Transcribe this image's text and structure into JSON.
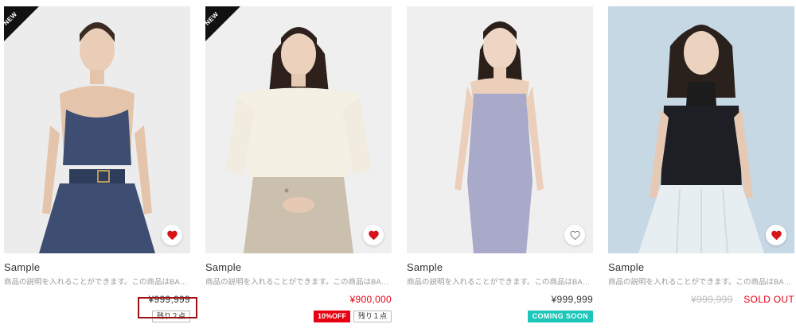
{
  "products": [
    {
      "name": "Sample",
      "description": "商品の説明を入れることができます。この商品はBAS...",
      "price": "¥999,999",
      "badge": "NEW",
      "stock_tag": "残り２点",
      "favorite": "filled"
    },
    {
      "name": "Sample",
      "description": "商品の説明を入れることができます。この商品はBAS...",
      "price": "¥900,000",
      "badge": "NEW",
      "sale_tag": "10%OFF",
      "stock_tag": "残り１点",
      "favorite": "filled"
    },
    {
      "name": "Sample",
      "description": "商品の説明を入れることができます。この商品はBAS...",
      "price": "¥999,999",
      "status_tag": "COMING SOON",
      "favorite": "outline"
    },
    {
      "name": "Sample",
      "description": "商品の説明を入れることができます。この商品はBAS...",
      "price": "¥999,999",
      "sold_out": "SOLD OUT",
      "favorite": "filled"
    }
  ],
  "colors": {
    "accent_red": "#e60012",
    "coming_soon": "#1cc6b8",
    "highlight": "#a01012"
  },
  "icons": {
    "favorite": "heart-icon",
    "badge": "new-ribbon"
  }
}
